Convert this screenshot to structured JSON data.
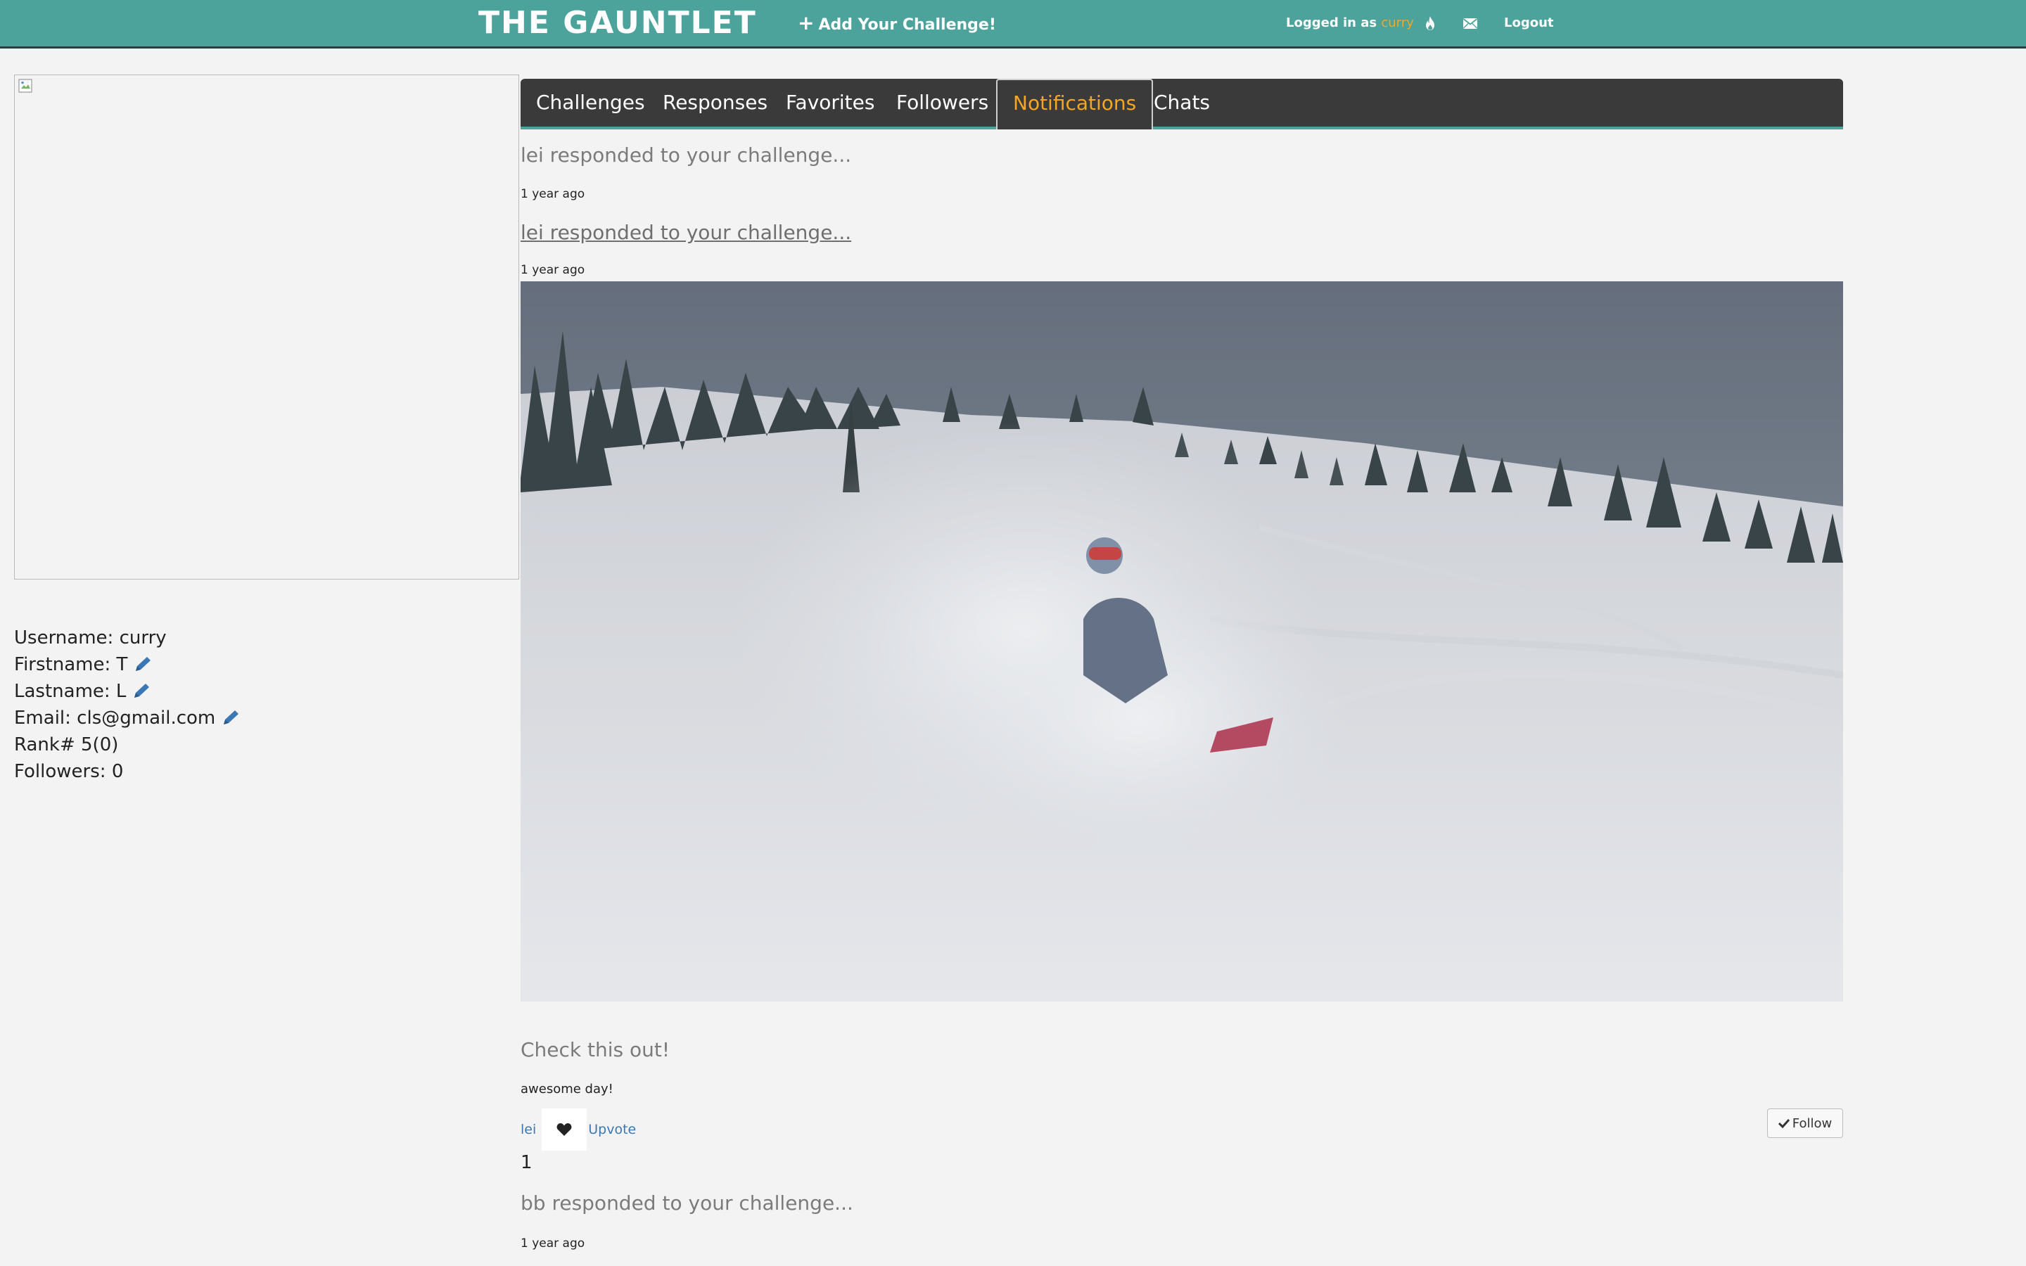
{
  "header": {
    "brand": "THE GAUNTLET",
    "add_challenge_label": "Add Your Challenge!",
    "logged_in_prefix": "Logged in as",
    "username": "curry",
    "logout_label": "Logout",
    "accent_color": "#4ba39c",
    "highlight_color": "#f5a623"
  },
  "profile": {
    "username_label": "Username:",
    "username": "curry",
    "firstname_label": "Firstname:",
    "firstname": "T",
    "lastname_label": "Lastname:",
    "lastname": "L",
    "email_label": "Email:",
    "email": "cls@gmail.com",
    "rank_label": "Rank#",
    "rank": "5(0)",
    "followers_label": "Followers:",
    "followers": "0"
  },
  "tabs": [
    {
      "label": "Challenges"
    },
    {
      "label": "Responses"
    },
    {
      "label": "Favorites"
    },
    {
      "label": "Followers"
    },
    {
      "label": "Notifications",
      "active": true
    },
    {
      "label": "Chats"
    }
  ],
  "notifications": [
    {
      "text": "lei responded to your challenge...",
      "time": "1 year ago"
    },
    {
      "text": "lei responded to your challenge...",
      "time": "1 year ago"
    },
    {
      "text": "bb responded to your challenge...",
      "time": "1 year ago"
    }
  ],
  "post": {
    "title": "Check this out!",
    "description": "awesome day!",
    "author": "lei",
    "upvote_label": "Upvote",
    "votes": "1",
    "follow_label": "Follow"
  }
}
